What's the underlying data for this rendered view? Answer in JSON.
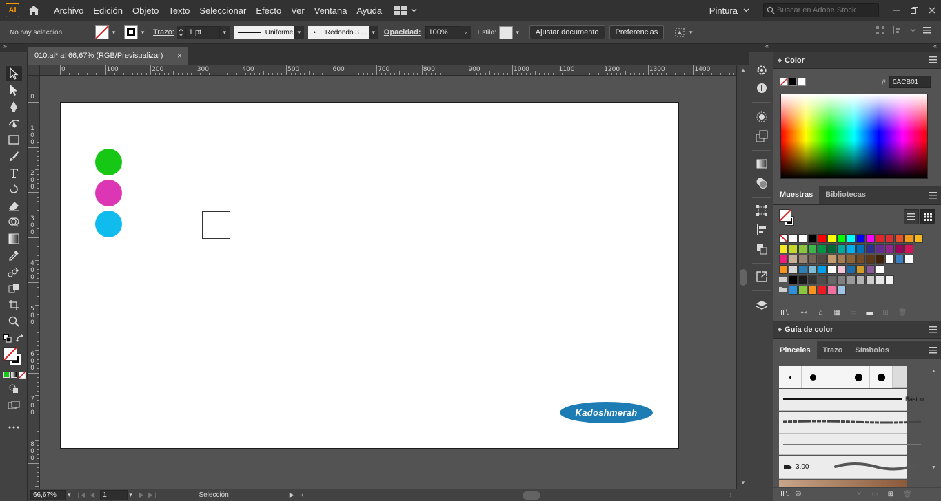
{
  "app": {
    "logo": "Ai",
    "menus": [
      "Archivo",
      "Edición",
      "Objeto",
      "Texto",
      "Seleccionar",
      "Efecto",
      "Ver",
      "Ventana",
      "Ayuda"
    ],
    "workspace": "Pintura",
    "stock_search_placeholder": "Buscar en Adobe Stock"
  },
  "control_bar": {
    "selection_status": "No hay selección",
    "stroke_label": "Trazo:",
    "stroke_weight": "1 pt",
    "stroke_profile": "Uniforme",
    "brush": "Redondo 3 ...",
    "opacity_label": "Opacidad:",
    "opacity_value": "100%",
    "style_label": "Estilo:",
    "fit_document_button": "Ajustar documento",
    "preferences_button": "Preferencias"
  },
  "document": {
    "tab_title": "010.ai* al 66,67% (RGB/Previsualizar)",
    "close_glyph": "×",
    "ruler_h_labels": [
      "0",
      "100",
      "200",
      "300",
      "400",
      "500",
      "600",
      "700",
      "800",
      "900",
      "1000",
      "1100",
      "1200",
      "1300",
      "1400"
    ],
    "ruler_v_labels": [
      [
        "0"
      ],
      [
        "1",
        "0",
        "0"
      ],
      [
        "2",
        "0",
        "0"
      ],
      [
        "3",
        "0",
        "0"
      ],
      [
        "4",
        "0",
        "0"
      ],
      [
        "5",
        "0",
        "0"
      ],
      [
        "6",
        "0",
        "0"
      ],
      [
        "7",
        "0",
        "0"
      ],
      [
        "8",
        "0",
        "0"
      ]
    ]
  },
  "artwork": {
    "circles": [
      {
        "name": "green-circle",
        "color": "#16c716"
      },
      {
        "name": "magenta-circle",
        "color": "#dc36b5"
      },
      {
        "name": "cyan-circle",
        "color": "#10bbee"
      }
    ],
    "brand_text": "Kadoshmerah",
    "brand_color": "#1c7cb3"
  },
  "status_bar": {
    "zoom": "66,67%",
    "artboard_number": "1",
    "tool_status": "Selección"
  },
  "color_panel": {
    "title": "Color",
    "hex_prefix": "#",
    "hex_value": "0ACB01"
  },
  "swatches_panel": {
    "tabs": [
      "Muestras",
      "Bibliotecas"
    ],
    "rows": [
      [
        "none",
        "#ffffff",
        "#ffffff",
        "#000000",
        "#ff0000",
        "#ffff00",
        "#00ff00",
        "#00ffff",
        "#0000ff",
        "#ff00ff",
        "#e0262b",
        "#dc2f2f",
        "#e65226",
        "#f39a1a",
        "#f5b81f"
      ],
      [
        "#f4ea25",
        "#c6d82c",
        "#8cc63f",
        "#39b54a",
        "#009245",
        "#006837",
        "#00a99d",
        "#00aeef",
        "#0071bc",
        "#2e3192",
        "#662d91",
        "#93278f",
        "#9e005d",
        "#d4145a"
      ],
      [
        "#ed1e79",
        "#c7b299",
        "#998675",
        "#736357",
        "#534741",
        "#c69c6d",
        "#a67c52",
        "#8c6239",
        "#754c24",
        "#603813",
        "#42210b",
        "#ffffff",
        "#3a7fc1",
        "#ffffff"
      ],
      [
        "#f7931e",
        "#d7d7d7",
        "#2b80b8",
        "#7dbcd6",
        "#00a0e9",
        "#ffffff",
        "#f1c6d6",
        "#1b6ea8",
        "#d39c2a",
        "#8a5a9a",
        "#ffffff"
      ],
      [
        "folder",
        "#000000",
        "#1a1a1a",
        "#333333",
        "#4d4d4d",
        "#666666",
        "#808080",
        "#999999",
        "#b3b3b3",
        "#cccccc",
        "#e6e6e6",
        "#f2f2f2"
      ],
      [
        "folder",
        "#2f8fd9",
        "#8cc63f",
        "#f7931e",
        "#ed1c24",
        "#f36fa0",
        "#a0c4e6"
      ]
    ]
  },
  "color_guide_panel": {
    "title": "Guía de color"
  },
  "brushes_panel": {
    "tabs": [
      "Pinceles",
      "Trazo",
      "Símbolos"
    ],
    "basic_label": "Básico",
    "size_value": "3,00"
  }
}
